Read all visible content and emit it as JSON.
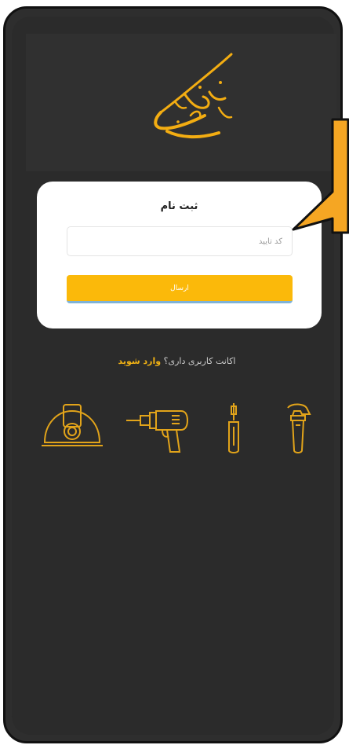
{
  "logo": {
    "text": "عمران کوه",
    "color": "#f3ad12"
  },
  "register_card": {
    "title": "ثبت نام",
    "code_input": {
      "placeholder": "کد تایید",
      "value": ""
    },
    "submit_label": "ارسال"
  },
  "account_prompt": {
    "question": "اکانت کاربری داری؟",
    "login_link": "وارد شوید"
  },
  "tool_icons": [
    "helmet-icon",
    "drill-icon",
    "screwdriver-icon",
    "pipe-wrench-icon"
  ],
  "colors": {
    "background": "#2e2e2e",
    "accent": "#fbb90a",
    "card": "#ffffff",
    "callout": "#f5a623"
  }
}
